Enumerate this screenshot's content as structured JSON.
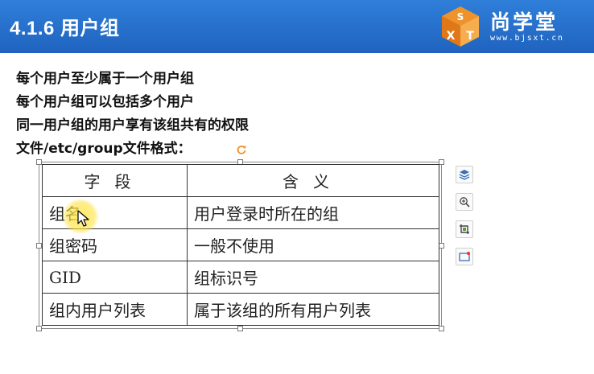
{
  "header": {
    "title": "4.1.6 用户组",
    "background": "#2469c8"
  },
  "logo": {
    "mark_letters": [
      "S",
      "X",
      "T"
    ],
    "name": "尚学堂",
    "url": "www.bjsxt.cn"
  },
  "content": {
    "lines": [
      "每个用户至少属于一个用户组",
      "每个用户组可以包括多个用户",
      "同一用户组的用户享有该组共有的权限",
      "文件/etc/group文件格式："
    ]
  },
  "table": {
    "headers": [
      "字段",
      "含义"
    ],
    "rows": [
      [
        "组名",
        "用户登录时所在的组"
      ],
      [
        "组密码",
        "一般不使用"
      ],
      [
        "GID",
        "组标识号"
      ],
      [
        "组内用户列表",
        "属于该组的所有用户列表"
      ]
    ]
  },
  "side_toolbar": {
    "icons": [
      "layers-icon",
      "zoom-in-icon",
      "crop-icon",
      "picture-frame-icon"
    ]
  },
  "colors": {
    "header_blue": "#2469c8",
    "logo_orange": "#f0922a",
    "cursor_highlight": "#ffe13c"
  }
}
